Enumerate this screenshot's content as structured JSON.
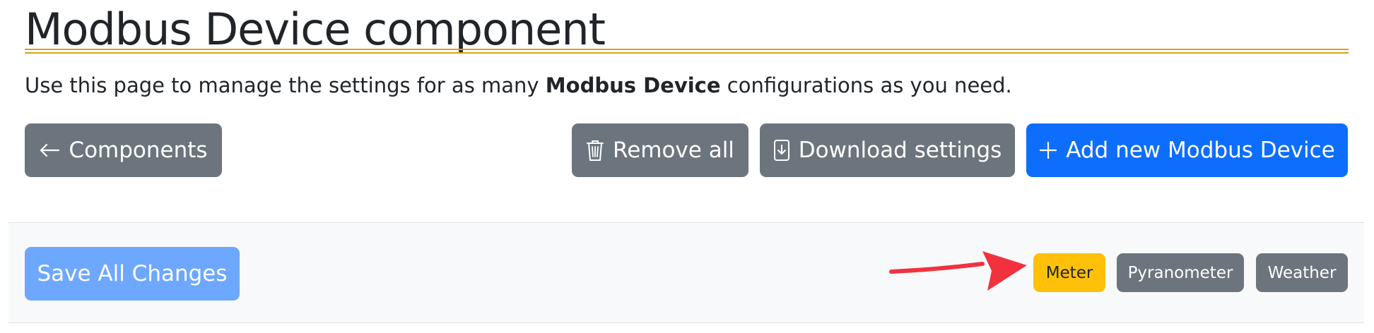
{
  "page": {
    "title": "Modbus Device component",
    "intro": {
      "before": "Use this page to manage the settings for as many ",
      "bold": "Modbus Device",
      "after": " configurations as you need."
    }
  },
  "actions": {
    "components_label": "Components",
    "remove_all_label": "Remove all",
    "download_label": "Download settings",
    "add_new_label": "Add new Modbus Device"
  },
  "toolbar": {
    "save_all_label": "Save All Changes",
    "tabs": [
      {
        "label": "Meter",
        "active": true
      },
      {
        "label": "Pyranometer",
        "active": false
      },
      {
        "label": "Weather",
        "active": false
      }
    ]
  },
  "colors": {
    "accent_rule": "#d4a21c",
    "primary": "#0d6efd",
    "primary_disabled": "#6ea8fe",
    "secondary": "#6c757d",
    "warning": "#ffc107",
    "annotation_arrow": "#f1323e"
  },
  "icons": {
    "components": "arrow-left-icon",
    "remove_all": "trash-icon",
    "download": "file-download-icon",
    "add_new": "plus-icon"
  }
}
